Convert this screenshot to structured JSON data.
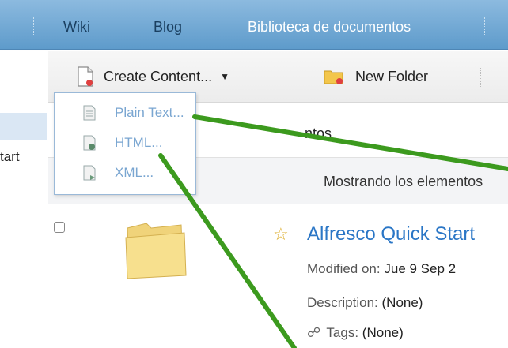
{
  "nav": {
    "items": [
      {
        "label": "Wiki"
      },
      {
        "label": "Blog"
      },
      {
        "label": "Biblioteca de documentos"
      }
    ]
  },
  "sidebar": {
    "partial_label": "tart"
  },
  "toolbar": {
    "create_content_label": "Create Content...",
    "new_folder_label": "New Folder"
  },
  "dropdown": {
    "items": [
      {
        "label": "Plain Text..."
      },
      {
        "label": "HTML..."
      },
      {
        "label": "XML..."
      }
    ]
  },
  "content": {
    "partial_header": "ntos",
    "showing_text": "Mostrando los elementos",
    "item": {
      "title": "Alfresco Quick Start",
      "modified_label": "Modified on:",
      "modified_value": "Jue 9 Sep 2",
      "description_label": "Description:",
      "description_value": "(None)",
      "tags_label": "Tags:",
      "tags_value": "(None)"
    }
  },
  "colors": {
    "nav_bg": "#6fa7d4",
    "link": "#2a76c6",
    "menu_text": "#7aa6d1",
    "annotation_line": "#3c9a1e"
  },
  "icons": {
    "create_content": "document-add-icon",
    "new_folder": "folder-icon",
    "plain_text": "text-document-icon",
    "html": "html-document-icon",
    "xml": "xml-document-icon",
    "star": "star-icon",
    "tags": "tag-icon"
  }
}
